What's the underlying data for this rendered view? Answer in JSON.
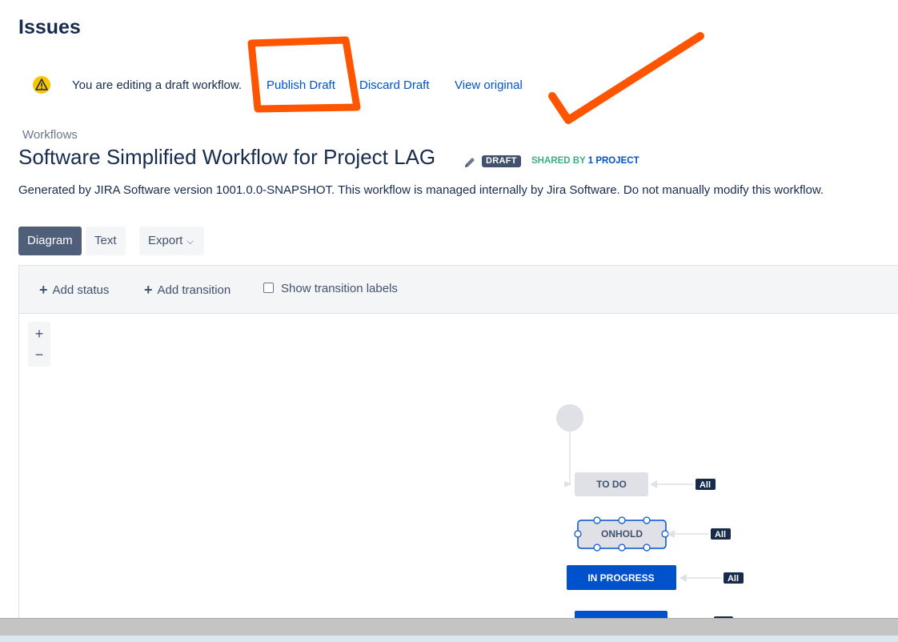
{
  "page": {
    "title": "Issues"
  },
  "draft_bar": {
    "message": "You are editing a draft workflow.",
    "publish": "Publish Draft",
    "discard": "Discard Draft",
    "view_original": "View original"
  },
  "breadcrumb": "Workflows",
  "workflow": {
    "title": "Software Simplified Workflow for Project LAG",
    "lozenge": "DRAFT",
    "shared_prefix": "SHARED BY",
    "shared_count": "1 PROJECT",
    "description": "Generated by JIRA Software version 1001.0.0-SNAPSHOT. This workflow is managed internally by Jira Software. Do not manually modify this workflow."
  },
  "view_buttons": {
    "diagram": "Diagram",
    "text": "Text",
    "export": "Export"
  },
  "toolbar": {
    "add_status": "Add status",
    "add_transition": "Add transition",
    "show_labels": "Show transition labels"
  },
  "zoom": {
    "in": "+",
    "out": "−"
  },
  "diagram": {
    "statuses": [
      {
        "name": "TO DO",
        "category": "todo"
      },
      {
        "name": "ONHOLD",
        "category": "todo"
      },
      {
        "name": "IN PROGRESS",
        "category": "inprogress"
      }
    ],
    "all_label": "All"
  },
  "colors": {
    "accent": "#0052cc",
    "todo_fill": "#dfe1e6",
    "inprogress_fill": "#0052cc",
    "annotation": "#ff5500"
  }
}
